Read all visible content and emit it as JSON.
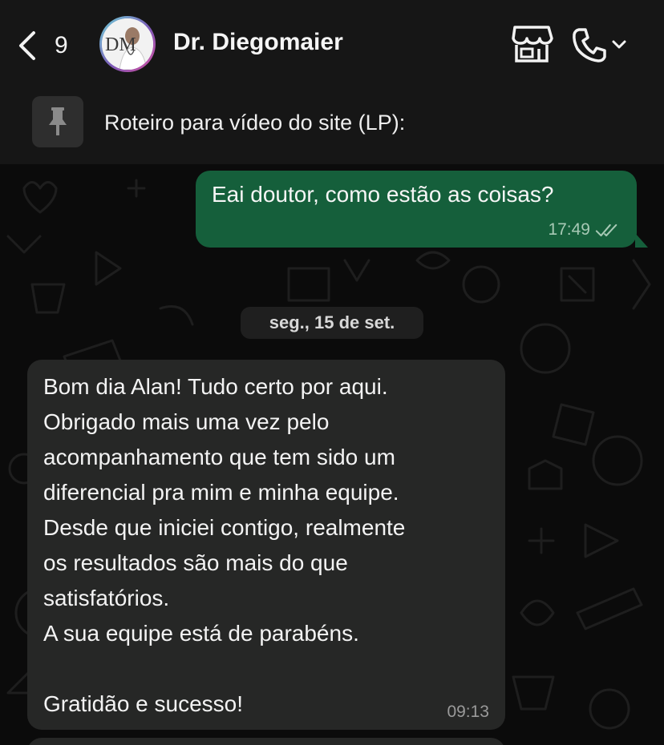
{
  "header": {
    "back_count": "9",
    "contact_name": "Dr. Diegomaier",
    "avatar_initials": "DM",
    "icons": [
      "chevron-left-icon",
      "storefront-icon",
      "phone-icon",
      "chevron-down-icon"
    ]
  },
  "pinned": {
    "icon": "pin-icon",
    "text": "Roteiro para vídeo do site (LP):"
  },
  "messages": {
    "outgoing": {
      "text": "Eai doutor, como estão as coisas?",
      "time": "17:49",
      "status_icon": "double-check-icon"
    },
    "date_separator": "seg., 15 de set.",
    "incoming": {
      "lines": [
        "Bom dia Alan! Tudo certo por aqui.",
        "Obrigado mais uma vez pelo",
        "acompanhamento que tem sido um",
        "diferencial pra mim e minha equipe.",
        "Desde que iniciei contigo, realmente",
        "os resultados são mais do que",
        "satisfatórios.",
        "A sua equipe está de parabéns.",
        "",
        "Gratidão e sucesso!"
      ],
      "time": "09:13"
    }
  },
  "colors": {
    "header_bg": "#161616",
    "chat_bg": "#0b0b0b",
    "outgoing_bubble": "#155f3b",
    "incoming_bubble": "#262726",
    "date_chip": "#1f1f1f"
  }
}
